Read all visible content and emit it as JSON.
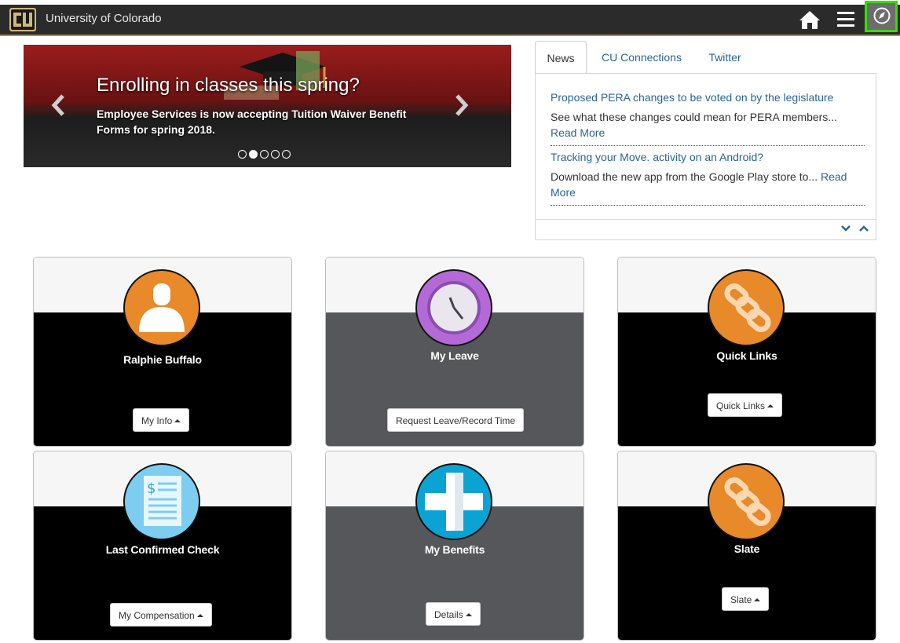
{
  "header": {
    "brand": "University of Colorado",
    "logo_text": "CU"
  },
  "carousel": {
    "title": "Enrolling in classes this spring?",
    "text": "Employee Services is now accepting Tuition Waiver Benefit Forms for spring 2018.",
    "slides": 5,
    "active_slide": 2
  },
  "news": {
    "tabs": [
      {
        "label": "News",
        "active": true
      },
      {
        "label": "CU Connections",
        "active": false
      },
      {
        "label": "Twitter",
        "active": false
      }
    ],
    "items": [
      {
        "headline": "Proposed PERA changes to be voted on by the legislature",
        "summary": "See what these changes could mean for PERA members...",
        "read_more": "Read More"
      },
      {
        "headline": "Tracking your Move. activity on an Android?",
        "summary": "Download the new app from the Google Play store to...",
        "read_more_1": "Read",
        "read_more_2": "More"
      }
    ]
  },
  "cards": [
    {
      "label": "Ralphie Buffalo",
      "button": "My Info",
      "icon": "user-icon"
    },
    {
      "label": "My Leave",
      "button": "Request Leave/Record Time",
      "icon": "clock-icon"
    },
    {
      "label": "Quick Links",
      "button": "Quick Links",
      "icon": "link-icon"
    },
    {
      "label": "Last Confirmed Check",
      "button": "My Compensation",
      "icon": "paycheck-icon"
    },
    {
      "label": "My Benefits",
      "button": "Details",
      "icon": "medical-cross-icon"
    },
    {
      "label": "Slate",
      "button": "Slate",
      "icon": "link-icon"
    }
  ],
  "colors": {
    "header_bg": "#2b2b2b",
    "gold_accent": "#a88f4f",
    "link_blue": "#2a6496",
    "orange": "#e8892a",
    "purple": "#b36ad6",
    "cyan": "#0aa3d4",
    "highlight_green": "#33e000"
  }
}
